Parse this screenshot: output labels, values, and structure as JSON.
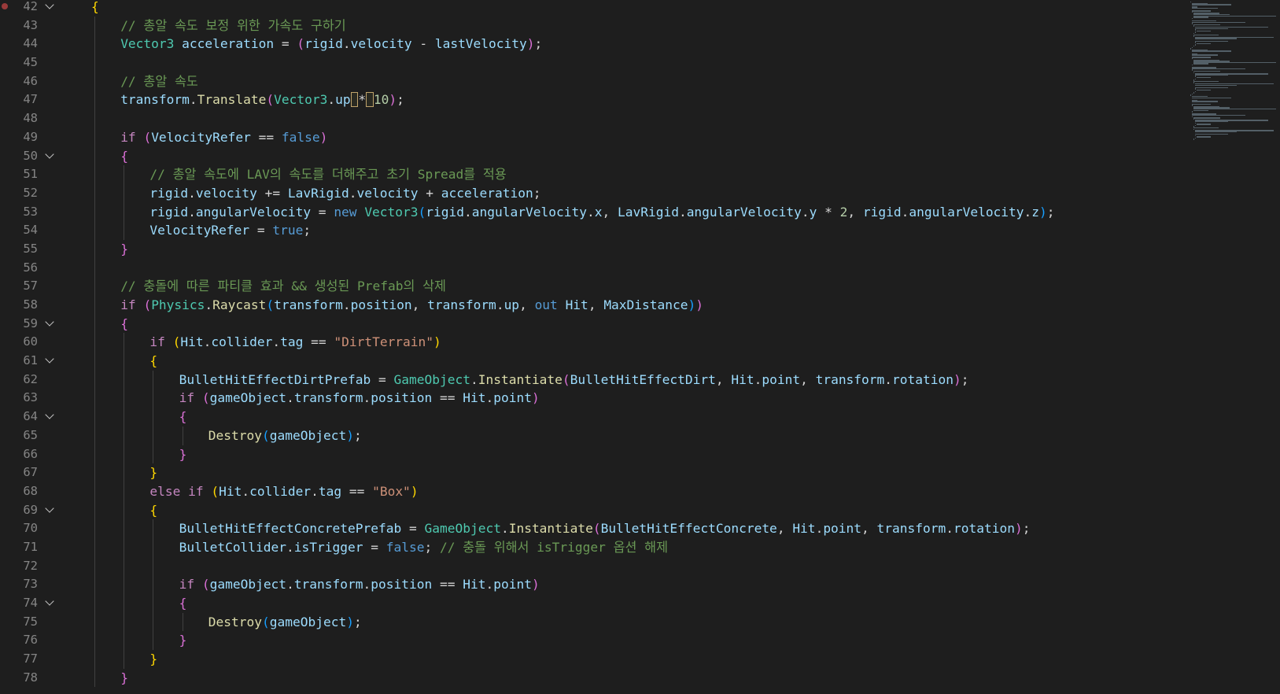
{
  "editor": {
    "lines": [
      {
        "num": "42",
        "fold": true,
        "breakpoint": true,
        "indent": 0,
        "tokens": [
          [
            "{",
            "t-brace1"
          ]
        ]
      },
      {
        "num": "43",
        "fold": false,
        "indent": 1,
        "tokens": [
          [
            "// 총알 속도 보정 위한 가속도 구하기",
            "t-comment"
          ]
        ]
      },
      {
        "num": "44",
        "fold": false,
        "indent": 1,
        "tokens": [
          [
            "Vector3",
            "t-type"
          ],
          [
            " ",
            "t-default"
          ],
          [
            "acceleration",
            "t-var"
          ],
          [
            " = ",
            "t-default"
          ],
          [
            "(",
            "t-brace2"
          ],
          [
            "rigid",
            "t-var"
          ],
          [
            ".",
            "t-default"
          ],
          [
            "velocity",
            "t-var"
          ],
          [
            " - ",
            "t-default"
          ],
          [
            "lastVelocity",
            "t-var"
          ],
          [
            ")",
            "t-brace2"
          ],
          [
            ";",
            "t-default"
          ]
        ]
      },
      {
        "num": "45",
        "fold": false,
        "indent": 1,
        "tokens": []
      },
      {
        "num": "46",
        "fold": false,
        "indent": 1,
        "tokens": [
          [
            "// 총알 속도",
            "t-comment"
          ]
        ]
      },
      {
        "num": "47",
        "fold": false,
        "indent": 1,
        "tokens": [
          [
            "transform",
            "t-var"
          ],
          [
            ".",
            "t-default"
          ],
          [
            "Translate",
            "t-method"
          ],
          [
            "(",
            "t-brace2"
          ],
          [
            "Vector3",
            "t-type"
          ],
          [
            ".",
            "t-default"
          ],
          [
            "up",
            "t-var"
          ],
          [
            " ",
            "t-cursorbox"
          ],
          [
            "*",
            "t-default"
          ],
          [
            " ",
            "t-cursorbox"
          ],
          [
            "10",
            "t-number"
          ],
          [
            ")",
            "t-brace2"
          ],
          [
            ";",
            "t-default"
          ]
        ]
      },
      {
        "num": "48",
        "fold": false,
        "indent": 1,
        "tokens": []
      },
      {
        "num": "49",
        "fold": false,
        "indent": 1,
        "tokens": [
          [
            "if",
            "t-keyword"
          ],
          [
            " ",
            "t-default"
          ],
          [
            "(",
            "t-brace2"
          ],
          [
            "VelocityRefer",
            "t-var"
          ],
          [
            " == ",
            "t-default"
          ],
          [
            "false",
            "t-keyword-blue"
          ],
          [
            ")",
            "t-brace2"
          ]
        ]
      },
      {
        "num": "50",
        "fold": true,
        "indent": 1,
        "tokens": [
          [
            "{",
            "t-brace2"
          ]
        ]
      },
      {
        "num": "51",
        "fold": false,
        "indent": 2,
        "tokens": [
          [
            "// 총알 속도에 LAV의 속도를 더해주고 초기 Spread를 적용",
            "t-comment"
          ]
        ]
      },
      {
        "num": "52",
        "fold": false,
        "indent": 2,
        "tokens": [
          [
            "rigid",
            "t-var"
          ],
          [
            ".",
            "t-default"
          ],
          [
            "velocity",
            "t-var"
          ],
          [
            " += ",
            "t-default"
          ],
          [
            "LavRigid",
            "t-var"
          ],
          [
            ".",
            "t-default"
          ],
          [
            "velocity",
            "t-var"
          ],
          [
            " + ",
            "t-default"
          ],
          [
            "acceleration",
            "t-var"
          ],
          [
            ";",
            "t-default"
          ]
        ]
      },
      {
        "num": "53",
        "fold": false,
        "indent": 2,
        "tokens": [
          [
            "rigid",
            "t-var"
          ],
          [
            ".",
            "t-default"
          ],
          [
            "angularVelocity",
            "t-var"
          ],
          [
            " = ",
            "t-default"
          ],
          [
            "new",
            "t-keyword-blue"
          ],
          [
            " ",
            "t-default"
          ],
          [
            "Vector3",
            "t-type"
          ],
          [
            "(",
            "t-brace3"
          ],
          [
            "rigid",
            "t-var"
          ],
          [
            ".",
            "t-default"
          ],
          [
            "angularVelocity",
            "t-var"
          ],
          [
            ".",
            "t-default"
          ],
          [
            "x",
            "t-var"
          ],
          [
            ", ",
            "t-default"
          ],
          [
            "LavRigid",
            "t-var"
          ],
          [
            ".",
            "t-default"
          ],
          [
            "angularVelocity",
            "t-var"
          ],
          [
            ".",
            "t-default"
          ],
          [
            "y",
            "t-var"
          ],
          [
            " * ",
            "t-default"
          ],
          [
            "2",
            "t-number"
          ],
          [
            ", ",
            "t-default"
          ],
          [
            "rigid",
            "t-var"
          ],
          [
            ".",
            "t-default"
          ],
          [
            "angularVelocity",
            "t-var"
          ],
          [
            ".",
            "t-default"
          ],
          [
            "z",
            "t-var"
          ],
          [
            ")",
            "t-brace3"
          ],
          [
            ";",
            "t-default"
          ]
        ]
      },
      {
        "num": "54",
        "fold": false,
        "indent": 2,
        "tokens": [
          [
            "VelocityRefer",
            "t-var"
          ],
          [
            " = ",
            "t-default"
          ],
          [
            "true",
            "t-keyword-blue"
          ],
          [
            ";",
            "t-default"
          ]
        ]
      },
      {
        "num": "55",
        "fold": false,
        "indent": 1,
        "tokens": [
          [
            "}",
            "t-brace2"
          ]
        ]
      },
      {
        "num": "56",
        "fold": false,
        "indent": 1,
        "tokens": []
      },
      {
        "num": "57",
        "fold": false,
        "indent": 1,
        "tokens": [
          [
            "// 충돌에 따른 파티클 효과 && 생성된 Prefab의 삭제",
            "t-comment"
          ]
        ]
      },
      {
        "num": "58",
        "fold": false,
        "indent": 1,
        "tokens": [
          [
            "if",
            "t-keyword"
          ],
          [
            " ",
            "t-default"
          ],
          [
            "(",
            "t-brace2"
          ],
          [
            "Physics",
            "t-type"
          ],
          [
            ".",
            "t-default"
          ],
          [
            "Raycast",
            "t-method"
          ],
          [
            "(",
            "t-brace3"
          ],
          [
            "transform",
            "t-var"
          ],
          [
            ".",
            "t-default"
          ],
          [
            "position",
            "t-var"
          ],
          [
            ", ",
            "t-default"
          ],
          [
            "transform",
            "t-var"
          ],
          [
            ".",
            "t-default"
          ],
          [
            "up",
            "t-var"
          ],
          [
            ", ",
            "t-default"
          ],
          [
            "out",
            "t-keyword-blue"
          ],
          [
            " ",
            "t-default"
          ],
          [
            "Hit",
            "t-var"
          ],
          [
            ", ",
            "t-default"
          ],
          [
            "MaxDistance",
            "t-var"
          ],
          [
            ")",
            "t-brace3"
          ],
          [
            ")",
            "t-brace2"
          ]
        ]
      },
      {
        "num": "59",
        "fold": true,
        "indent": 1,
        "tokens": [
          [
            "{",
            "t-brace2"
          ]
        ]
      },
      {
        "num": "60",
        "fold": false,
        "indent": 2,
        "tokens": [
          [
            "if",
            "t-keyword"
          ],
          [
            " ",
            "t-default"
          ],
          [
            "(",
            "t-brace1"
          ],
          [
            "Hit",
            "t-var"
          ],
          [
            ".",
            "t-default"
          ],
          [
            "collider",
            "t-var"
          ],
          [
            ".",
            "t-default"
          ],
          [
            "tag",
            "t-var"
          ],
          [
            " == ",
            "t-default"
          ],
          [
            "\"DirtTerrain\"",
            "t-string"
          ],
          [
            ")",
            "t-brace1"
          ]
        ]
      },
      {
        "num": "61",
        "fold": true,
        "indent": 2,
        "tokens": [
          [
            "{",
            "t-brace1"
          ]
        ]
      },
      {
        "num": "62",
        "fold": false,
        "indent": 3,
        "tokens": [
          [
            "BulletHitEffectDirtPrefab",
            "t-var"
          ],
          [
            " = ",
            "t-default"
          ],
          [
            "GameObject",
            "t-type"
          ],
          [
            ".",
            "t-default"
          ],
          [
            "Instantiate",
            "t-method"
          ],
          [
            "(",
            "t-brace2"
          ],
          [
            "BulletHitEffectDirt",
            "t-var"
          ],
          [
            ", ",
            "t-default"
          ],
          [
            "Hit",
            "t-var"
          ],
          [
            ".",
            "t-default"
          ],
          [
            "point",
            "t-var"
          ],
          [
            ", ",
            "t-default"
          ],
          [
            "transform",
            "t-var"
          ],
          [
            ".",
            "t-default"
          ],
          [
            "rotation",
            "t-var"
          ],
          [
            ")",
            "t-brace2"
          ],
          [
            ";",
            "t-default"
          ]
        ]
      },
      {
        "num": "63",
        "fold": false,
        "indent": 3,
        "tokens": [
          [
            "if",
            "t-keyword"
          ],
          [
            " ",
            "t-default"
          ],
          [
            "(",
            "t-brace2"
          ],
          [
            "gameObject",
            "t-var"
          ],
          [
            ".",
            "t-default"
          ],
          [
            "transform",
            "t-var"
          ],
          [
            ".",
            "t-default"
          ],
          [
            "position",
            "t-var"
          ],
          [
            " == ",
            "t-default"
          ],
          [
            "Hit",
            "t-var"
          ],
          [
            ".",
            "t-default"
          ],
          [
            "point",
            "t-var"
          ],
          [
            ")",
            "t-brace2"
          ]
        ]
      },
      {
        "num": "64",
        "fold": true,
        "indent": 3,
        "tokens": [
          [
            "{",
            "t-brace2"
          ]
        ]
      },
      {
        "num": "65",
        "fold": false,
        "indent": 4,
        "tokens": [
          [
            "Destroy",
            "t-method"
          ],
          [
            "(",
            "t-brace3"
          ],
          [
            "gameObject",
            "t-var"
          ],
          [
            ")",
            "t-brace3"
          ],
          [
            ";",
            "t-default"
          ]
        ]
      },
      {
        "num": "66",
        "fold": false,
        "indent": 3,
        "tokens": [
          [
            "}",
            "t-brace2"
          ]
        ]
      },
      {
        "num": "67",
        "fold": false,
        "indent": 2,
        "tokens": [
          [
            "}",
            "t-brace1"
          ]
        ]
      },
      {
        "num": "68",
        "fold": false,
        "indent": 2,
        "tokens": [
          [
            "else",
            "t-keyword"
          ],
          [
            " ",
            "t-default"
          ],
          [
            "if",
            "t-keyword"
          ],
          [
            " ",
            "t-default"
          ],
          [
            "(",
            "t-brace1"
          ],
          [
            "Hit",
            "t-var"
          ],
          [
            ".",
            "t-default"
          ],
          [
            "collider",
            "t-var"
          ],
          [
            ".",
            "t-default"
          ],
          [
            "tag",
            "t-var"
          ],
          [
            " == ",
            "t-default"
          ],
          [
            "\"Box\"",
            "t-string"
          ],
          [
            ")",
            "t-brace1"
          ]
        ]
      },
      {
        "num": "69",
        "fold": true,
        "indent": 2,
        "tokens": [
          [
            "{",
            "t-brace1"
          ]
        ]
      },
      {
        "num": "70",
        "fold": false,
        "indent": 3,
        "tokens": [
          [
            "BulletHitEffectConcretePrefab",
            "t-var"
          ],
          [
            " = ",
            "t-default"
          ],
          [
            "GameObject",
            "t-type"
          ],
          [
            ".",
            "t-default"
          ],
          [
            "Instantiate",
            "t-method"
          ],
          [
            "(",
            "t-brace2"
          ],
          [
            "BulletHitEffectConcrete",
            "t-var"
          ],
          [
            ", ",
            "t-default"
          ],
          [
            "Hit",
            "t-var"
          ],
          [
            ".",
            "t-default"
          ],
          [
            "point",
            "t-var"
          ],
          [
            ", ",
            "t-default"
          ],
          [
            "transform",
            "t-var"
          ],
          [
            ".",
            "t-default"
          ],
          [
            "rotation",
            "t-var"
          ],
          [
            ")",
            "t-brace2"
          ],
          [
            ";",
            "t-default"
          ]
        ]
      },
      {
        "num": "71",
        "fold": false,
        "indent": 3,
        "tokens": [
          [
            "BulletCollider",
            "t-var"
          ],
          [
            ".",
            "t-default"
          ],
          [
            "isTrigger",
            "t-var"
          ],
          [
            " = ",
            "t-default"
          ],
          [
            "false",
            "t-keyword-blue"
          ],
          [
            "; ",
            "t-default"
          ],
          [
            "// 충돌 위해서 isTrigger 옵션 해제",
            "t-comment"
          ]
        ]
      },
      {
        "num": "72",
        "fold": false,
        "indent": 3,
        "tokens": []
      },
      {
        "num": "73",
        "fold": false,
        "indent": 3,
        "tokens": [
          [
            "if",
            "t-keyword"
          ],
          [
            " ",
            "t-default"
          ],
          [
            "(",
            "t-brace2"
          ],
          [
            "gameObject",
            "t-var"
          ],
          [
            ".",
            "t-default"
          ],
          [
            "transform",
            "t-var"
          ],
          [
            ".",
            "t-default"
          ],
          [
            "position",
            "t-var"
          ],
          [
            " == ",
            "t-default"
          ],
          [
            "Hit",
            "t-var"
          ],
          [
            ".",
            "t-default"
          ],
          [
            "point",
            "t-var"
          ],
          [
            ")",
            "t-brace2"
          ]
        ]
      },
      {
        "num": "74",
        "fold": true,
        "indent": 3,
        "tokens": [
          [
            "{",
            "t-brace2"
          ]
        ]
      },
      {
        "num": "75",
        "fold": false,
        "indent": 4,
        "tokens": [
          [
            "Destroy",
            "t-method"
          ],
          [
            "(",
            "t-brace3"
          ],
          [
            "gameObject",
            "t-var"
          ],
          [
            ")",
            "t-brace3"
          ],
          [
            ";",
            "t-default"
          ]
        ]
      },
      {
        "num": "76",
        "fold": false,
        "indent": 3,
        "tokens": [
          [
            "}",
            "t-brace2"
          ]
        ]
      },
      {
        "num": "77",
        "fold": false,
        "indent": 2,
        "tokens": [
          [
            "}",
            "t-brace1"
          ]
        ]
      },
      {
        "num": "78",
        "fold": false,
        "indent": 1,
        "tokens": [
          [
            "}",
            "t-brace2"
          ]
        ]
      }
    ]
  },
  "colors": {
    "background": "#1e1e1e",
    "line_number": "#858585",
    "comment": "#6a9955",
    "keyword": "#c586c0",
    "type": "#4ec9b0",
    "variable": "#9cdcfe",
    "method": "#dcdcaa",
    "string": "#ce9178",
    "number": "#b5cea8"
  },
  "icons": {
    "fold": "chevron-down-icon",
    "breakpoint": "breakpoint-dot-icon"
  }
}
